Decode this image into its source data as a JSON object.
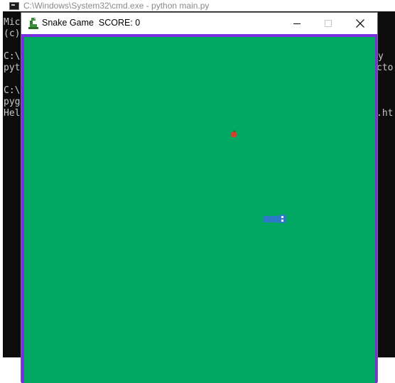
{
  "cmd": {
    "title": "C:\\Windows\\System32\\cmd.exe - python  main.py",
    "lines": [
      {
        "text": "Mic",
        "row": 0
      },
      {
        "text": "(c)",
        "row": 1
      },
      {
        "text": "C:\\",
        "row": 3
      },
      {
        "text": "pyt",
        "row": 4
      },
      {
        "text": "C:\\",
        "row": 6
      },
      {
        "text": "pyg",
        "row": 7
      },
      {
        "text": "Hel",
        "row": 8
      }
    ],
    "right_fragments": [
      {
        "text": "y",
        "row": 3
      },
      {
        "text": "cto",
        "row": 4
      },
      {
        "text": ".ht",
        "row": 8
      }
    ]
  },
  "game": {
    "title": "Snake Game  SCORE: 0",
    "icon": "python-snake-icon",
    "colors": {
      "border": "#7a2ee0",
      "field": "#00a862",
      "snake": "#2c78c9",
      "apple": "#e03a2c"
    }
  },
  "window_controls": {
    "minimize_icon": "minimize-icon",
    "maximize_icon": "maximize-icon",
    "close_icon": "close-icon"
  }
}
